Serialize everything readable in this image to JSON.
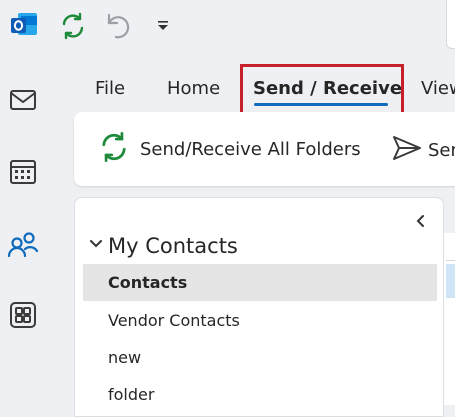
{
  "colors": {
    "accent": "#0f6cbd",
    "highlight_box": "#c7202b",
    "sync_green": "#1f8a3a",
    "rail_blue": "#0f6cbd",
    "selected_row": "#e5e5e5"
  },
  "title_bar": {
    "icons": [
      "outlook-logo-icon",
      "refresh-icon",
      "undo-icon",
      "customize-quick-access-icon"
    ]
  },
  "rail": {
    "icons": [
      "mail-icon",
      "calendar-icon",
      "people-icon",
      "apps-icon"
    ]
  },
  "ribbon": {
    "tabs": [
      {
        "label": "File"
      },
      {
        "label": "Home"
      },
      {
        "label": "Send / Receive",
        "selected": true
      },
      {
        "label": "View"
      }
    ],
    "send_receive_all_label": "Send/Receive All Folders",
    "send_label": "Send"
  },
  "folders": {
    "group_label": "My Contacts",
    "items": [
      {
        "label": "Contacts",
        "selected": true
      },
      {
        "label": "Vendor Contacts"
      },
      {
        "label": "new"
      },
      {
        "label": "folder"
      }
    ]
  }
}
